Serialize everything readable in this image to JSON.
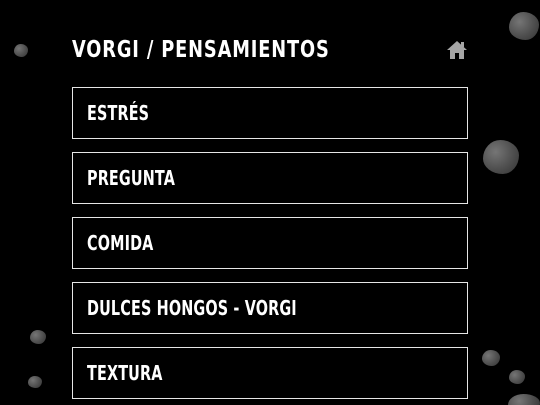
{
  "header": {
    "title": "VORGI / PENSAMIENTOS",
    "home_icon": "home-icon"
  },
  "menu": {
    "items": [
      {
        "label": "ESTRÉS"
      },
      {
        "label": "PREGUNTA"
      },
      {
        "label": "COMIDA"
      },
      {
        "label": "DULCES HONGOS - VORGI"
      },
      {
        "label": "TEXTURA"
      }
    ]
  },
  "colors": {
    "background": "#000000",
    "text": "#ffffff",
    "border": "#e6e6e6",
    "icon": "#a6a6a6"
  }
}
